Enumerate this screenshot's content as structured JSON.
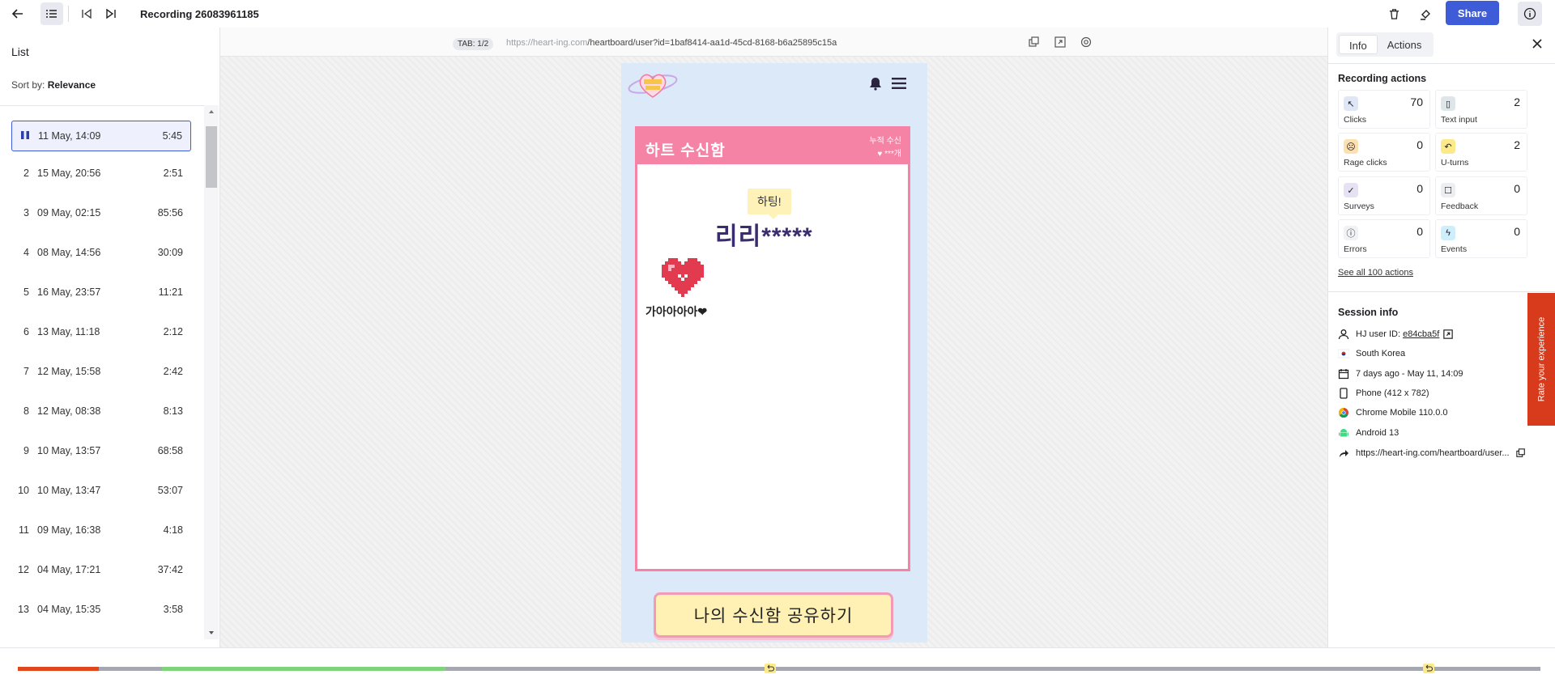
{
  "topbar": {
    "recording_title": "Recording 26083961185",
    "share_label": "Share",
    "icons": [
      "arrow-left-icon",
      "list-icon",
      "skip-previous-icon",
      "skip-next-icon",
      "trash-icon",
      "highlight-icon",
      "info-icon"
    ]
  },
  "left_panel": {
    "title": "List",
    "sort_prefix": "Sort by:",
    "sort_value": "Relevance",
    "rows": [
      {
        "num": "",
        "date": "11 May, 14:09",
        "duration": "5:45",
        "active": true
      },
      {
        "num": "2",
        "date": "15 May, 20:56",
        "duration": "2:51"
      },
      {
        "num": "3",
        "date": "09 May, 02:15",
        "duration": "85:56"
      },
      {
        "num": "4",
        "date": "08 May, 14:56",
        "duration": "30:09"
      },
      {
        "num": "5",
        "date": "16 May, 23:57",
        "duration": "11:21"
      },
      {
        "num": "6",
        "date": "13 May, 11:18",
        "duration": "2:12"
      },
      {
        "num": "7",
        "date": "12 May, 15:58",
        "duration": "2:42"
      },
      {
        "num": "8",
        "date": "12 May, 08:38",
        "duration": "8:13"
      },
      {
        "num": "9",
        "date": "10 May, 13:57",
        "duration": "68:58"
      },
      {
        "num": "10",
        "date": "10 May, 13:47",
        "duration": "53:07"
      },
      {
        "num": "11",
        "date": "09 May, 16:38",
        "duration": "4:18"
      },
      {
        "num": "12",
        "date": "04 May, 17:21",
        "duration": "37:42"
      },
      {
        "num": "13",
        "date": "04 May, 15:35",
        "duration": "3:58"
      }
    ]
  },
  "viewer": {
    "tab_badge": "TAB: 1/2",
    "url_prefix": "https://heart-ing.com",
    "url_path": "/heartboard/user?id=1baf8414-aa1d-45cd-8168-b6a25895c15a",
    "card_title": "하트 수신함",
    "card_sub": "누적 수신",
    "card_count": "***개",
    "bubble": "하팅!",
    "recipient": "리리*****",
    "message": "가아아아아❤",
    "cta": "나의 수신함 공유하기"
  },
  "right_panel": {
    "tabs": [
      "Info",
      "Actions"
    ],
    "active_tab": "Info",
    "actions_title": "Recording actions",
    "stats": [
      {
        "label": "Clicks",
        "value": "70",
        "icon": "click-icon",
        "color": "#dfe6f5"
      },
      {
        "label": "Text input",
        "value": "2",
        "icon": "text-input-icon",
        "color": "#dfe6ea"
      },
      {
        "label": "Rage clicks",
        "value": "0",
        "icon": "rage-click-icon",
        "color": "#fde0b0"
      },
      {
        "label": "U-turns",
        "value": "2",
        "icon": "u-turn-icon",
        "color": "#fbe98a"
      },
      {
        "label": "Surveys",
        "value": "0",
        "icon": "survey-icon",
        "color": "#e6e2f4"
      },
      {
        "label": "Feedback",
        "value": "0",
        "icon": "feedback-icon",
        "color": "#eceef2"
      },
      {
        "label": "Errors",
        "value": "0",
        "icon": "error-icon",
        "color": "#f1f2f5"
      },
      {
        "label": "Events",
        "value": "0",
        "icon": "events-icon",
        "color": "#cdeefa"
      }
    ],
    "see_all": "See all 100 actions",
    "session_title": "Session info",
    "session": {
      "user_prefix": "HJ user ID:",
      "user_id": "e84cba5f",
      "country": "South Korea",
      "date": "7 days ago - May 11, 14:09",
      "device": "Phone (412 x 782)",
      "browser": "Chrome Mobile 110.0.0",
      "os": "Android 13",
      "referrer": "https://heart-ing.com/heartboard/user..."
    }
  },
  "feedback_tab": "Rate your experience",
  "timeline": {
    "colors": {
      "played": "#e0471b",
      "active": "#7fd37a",
      "idle": "#a6a8b0"
    }
  }
}
